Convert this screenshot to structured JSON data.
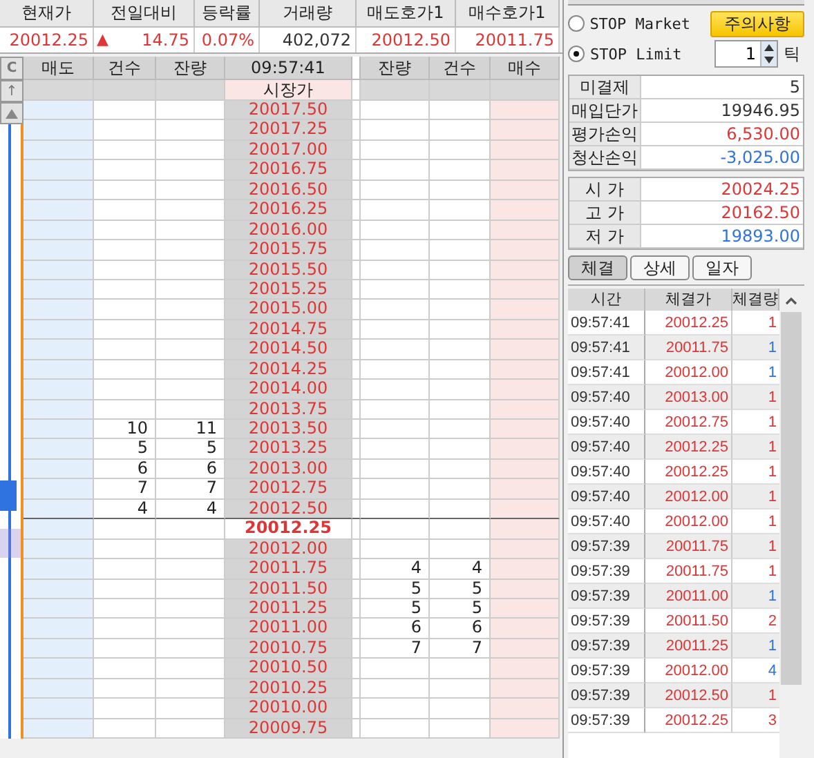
{
  "summary": {
    "columns": [
      "현재가",
      "전일대비",
      "등락률",
      "거래량",
      "매도호가1",
      "매수호가1"
    ],
    "values": [
      {
        "text": "20012.25",
        "color": "#e03535"
      },
      {
        "text": "14.75",
        "color": "#e03535",
        "mark": "▲"
      },
      {
        "text": "0.07%",
        "color": "#e03535"
      },
      {
        "text": "402,072",
        "color": "#333333"
      },
      {
        "text": "20012.50",
        "color": "#e03535"
      },
      {
        "text": "20011.75",
        "color": "#e03535"
      }
    ]
  },
  "side_buttons": [
    "C",
    "↑"
  ],
  "ladder": {
    "columns": [
      "매도",
      "건수",
      "잔량",
      "09:57:41",
      "잔량",
      "건수",
      "매수"
    ],
    "market_label": "시장가",
    "rows": [
      {
        "price": "20017.50",
        "current": false
      },
      {
        "price": "20017.25",
        "current": false
      },
      {
        "price": "20017.00",
        "current": false
      },
      {
        "price": "20016.75",
        "current": false
      },
      {
        "price": "20016.50",
        "current": false
      },
      {
        "price": "20016.25",
        "current": false
      },
      {
        "price": "20016.00",
        "current": false
      },
      {
        "price": "20015.75",
        "current": false
      },
      {
        "price": "20015.50",
        "current": false
      },
      {
        "price": "20015.25",
        "current": false
      },
      {
        "price": "20015.00",
        "current": false
      },
      {
        "price": "20014.75",
        "current": false
      },
      {
        "price": "20014.50",
        "current": false
      },
      {
        "price": "20014.25",
        "current": false
      },
      {
        "price": "20014.00",
        "current": false
      },
      {
        "price": "20013.75",
        "current": false
      },
      {
        "price": "20013.50",
        "current": false,
        "sell_count": "10",
        "sell_qty": "11"
      },
      {
        "price": "20013.25",
        "current": false,
        "sell_count": "5",
        "sell_qty": "5"
      },
      {
        "price": "20013.00",
        "current": false,
        "sell_count": "6",
        "sell_qty": "6"
      },
      {
        "price": "20012.75",
        "current": false,
        "sell_count": "7",
        "sell_qty": "7"
      },
      {
        "price": "20012.50",
        "current": false,
        "sell_count": "4",
        "sell_qty": "4"
      },
      {
        "price": "20012.25",
        "current": true
      },
      {
        "price": "20012.00",
        "current": false
      },
      {
        "price": "20011.75",
        "current": false,
        "buy_qty": "4",
        "buy_count": "4"
      },
      {
        "price": "20011.50",
        "current": false,
        "buy_qty": "5",
        "buy_count": "5"
      },
      {
        "price": "20011.25",
        "current": false,
        "buy_qty": "5",
        "buy_count": "5"
      },
      {
        "price": "20011.00",
        "current": false,
        "buy_qty": "6",
        "buy_count": "6"
      },
      {
        "price": "20010.75",
        "current": false,
        "buy_qty": "7",
        "buy_count": "7"
      },
      {
        "price": "20010.50",
        "current": false
      },
      {
        "price": "20010.25",
        "current": false
      },
      {
        "price": "20010.00",
        "current": false
      },
      {
        "price": "20009.75",
        "current": false
      }
    ]
  },
  "stop_options": [
    {
      "label": "STOP Market",
      "selected": false
    },
    {
      "label": "STOP Limit",
      "selected": true
    }
  ],
  "notice_button": "주의사항",
  "tick_spinner": {
    "value": "1",
    "unit": "틱"
  },
  "position": [
    {
      "label": "미결제",
      "value": "5",
      "color": "#333333"
    },
    {
      "label": "매입단가",
      "value": "19946.95",
      "color": "#333333"
    },
    {
      "label": "평가손익",
      "value": "6,530.00",
      "color": "#e03535"
    },
    {
      "label": "청산손익",
      "value": "-3,025.00",
      "color": "#2f73e0"
    }
  ],
  "prices": [
    {
      "label": "시 가",
      "value": "20024.25",
      "color": "#e03535"
    },
    {
      "label": "고 가",
      "value": "20162.50",
      "color": "#e03535"
    },
    {
      "label": "저 가",
      "value": "19893.00",
      "color": "#2f73e0"
    }
  ],
  "tabs": [
    {
      "label": "체결",
      "selected": true
    },
    {
      "label": "상세",
      "selected": false
    },
    {
      "label": "일자",
      "selected": false
    }
  ],
  "trades": {
    "columns": [
      "시간",
      "체결가",
      "체결량"
    ],
    "rows": [
      {
        "time": "09:57:41",
        "price": "20012.25",
        "qty": "1",
        "color": "#e03535"
      },
      {
        "time": "09:57:41",
        "price": "20011.75",
        "qty": "1",
        "color": "#2f73e0"
      },
      {
        "time": "09:57:41",
        "price": "20012.00",
        "qty": "1",
        "color": "#2f73e0"
      },
      {
        "time": "09:57:40",
        "price": "20013.00",
        "qty": "1",
        "color": "#e03535"
      },
      {
        "time": "09:57:40",
        "price": "20012.75",
        "qty": "1",
        "color": "#e03535"
      },
      {
        "time": "09:57:40",
        "price": "20012.25",
        "qty": "1",
        "color": "#e03535"
      },
      {
        "time": "09:57:40",
        "price": "20012.25",
        "qty": "1",
        "color": "#e03535"
      },
      {
        "time": "09:57:40",
        "price": "20012.00",
        "qty": "1",
        "color": "#e03535"
      },
      {
        "time": "09:57:40",
        "price": "20012.00",
        "qty": "1",
        "color": "#e03535"
      },
      {
        "time": "09:57:39",
        "price": "20011.75",
        "qty": "1",
        "color": "#e03535"
      },
      {
        "time": "09:57:39",
        "price": "20011.75",
        "qty": "1",
        "color": "#e03535"
      },
      {
        "time": "09:57:39",
        "price": "20011.00",
        "qty": "1",
        "color": "#2f73e0"
      },
      {
        "time": "09:57:39",
        "price": "20011.50",
        "qty": "2",
        "color": "#e03535"
      },
      {
        "time": "09:57:39",
        "price": "20011.25",
        "qty": "1",
        "color": "#2f73e0"
      },
      {
        "time": "09:57:39",
        "price": "20012.00",
        "qty": "4",
        "color": "#2f73e0"
      },
      {
        "time": "09:57:39",
        "price": "20012.50",
        "qty": "1",
        "color": "#e03535"
      },
      {
        "time": "09:57:39",
        "price": "20012.25",
        "qty": "3",
        "color": "#e03535"
      }
    ]
  }
}
